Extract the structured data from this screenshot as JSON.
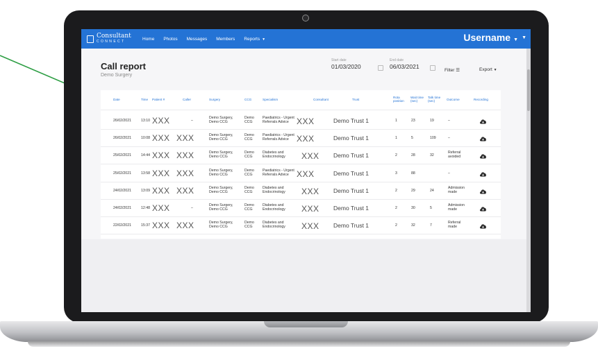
{
  "app": {
    "logo_line1": "Consultant",
    "logo_line2": "CONNECT",
    "username": "Username",
    "accent": "#2473d5"
  },
  "nav": {
    "items": [
      "Home",
      "Photos",
      "Messages",
      "Members",
      "Reports"
    ]
  },
  "page": {
    "title": "Call report",
    "subtitle": "Demo Surgery"
  },
  "filters": {
    "start_label": "Start date",
    "start_value": "01/03/2020",
    "end_label": "End date",
    "end_value": "06/03/2021",
    "filter_label": "Filter",
    "export_label": "Export"
  },
  "table": {
    "headers": [
      "Date",
      "Time",
      "Patient #",
      "Caller",
      "Surgery",
      "CCG",
      "Specialism",
      "Consultant",
      "Trust",
      "Rota position",
      "Wait time (sec)",
      "Talk time (sec)",
      "Outcome",
      "Recording"
    ],
    "rows": [
      {
        "date": "26/02/2021",
        "time": "13:10",
        "patient": "XXX",
        "caller": "–",
        "surgery": "Demo Surgery, Demo CCG",
        "ccg": "Demo CCG",
        "specialism": "Paediatrics - Urgent Referrals Advice",
        "consultant": "XXX",
        "trust": "Demo Trust 1",
        "rota": "1",
        "wait": "23",
        "talk": "19",
        "outcome": "–"
      },
      {
        "date": "26/02/2021",
        "time": "10:08",
        "patient": "XXX",
        "caller": "XXX",
        "surgery": "Demo Surgery, Demo CCG",
        "ccg": "Demo CCG",
        "specialism": "Paediatrics - Urgent Referrals Advice",
        "consultant": "XXX",
        "trust": "Demo Trust 1",
        "rota": "1",
        "wait": "5",
        "talk": "109",
        "outcome": "–"
      },
      {
        "date": "25/02/2021",
        "time": "14:44",
        "patient": "XXX",
        "caller": "XXX",
        "surgery": "Demo Surgery, Demo CCG",
        "ccg": "Demo CCG",
        "specialism": "Diabetes and Endocrinology",
        "consultant": "XXX",
        "trust": "Demo Trust 1",
        "rota": "2",
        "wait": "28",
        "talk": "32",
        "outcome": "Referral avoided"
      },
      {
        "date": "25/02/2021",
        "time": "13:58",
        "patient": "XXX",
        "caller": "XXX",
        "surgery": "Demo Surgery, Demo CCG",
        "ccg": "Demo CCG",
        "specialism": "Paediatrics - Urgent Referrals Advice",
        "consultant": "XXX",
        "trust": "Demo Trust 1",
        "rota": "3",
        "wait": "88",
        "talk": "",
        "outcome": "–"
      },
      {
        "date": "24/02/2021",
        "time": "13:09",
        "patient": "XXX",
        "caller": "XXX",
        "surgery": "Demo Surgery, Demo CCG",
        "ccg": "Demo CCG",
        "specialism": "Diabetes and Endocrinology",
        "consultant": "XXX",
        "trust": "Demo Trust 1",
        "rota": "2",
        "wait": "29",
        "talk": "24",
        "outcome": "Admission made"
      },
      {
        "date": "24/02/2021",
        "time": "12:48",
        "patient": "XXX",
        "caller": "–",
        "surgery": "Demo Surgery, Demo CCG",
        "ccg": "Demo CCG",
        "specialism": "Diabetes and Endocrinology",
        "consultant": "XXX",
        "trust": "Demo Trust 1",
        "rota": "2",
        "wait": "30",
        "talk": "5",
        "outcome": "Admission made"
      },
      {
        "date": "22/02/2021",
        "time": "15:37",
        "patient": "XXX",
        "caller": "XXX",
        "surgery": "Demo Surgery, Demo CCG",
        "ccg": "Demo CCG",
        "specialism": "Diabetes and Endocrinology",
        "consultant": "XXX",
        "trust": "Demo Trust 1",
        "rota": "2",
        "wait": "32",
        "talk": "7",
        "outcome": "Referral made"
      }
    ]
  },
  "icons": {
    "recording": "cloud-download-icon",
    "filter": "filter-icon",
    "calendar": "calendar-icon"
  }
}
